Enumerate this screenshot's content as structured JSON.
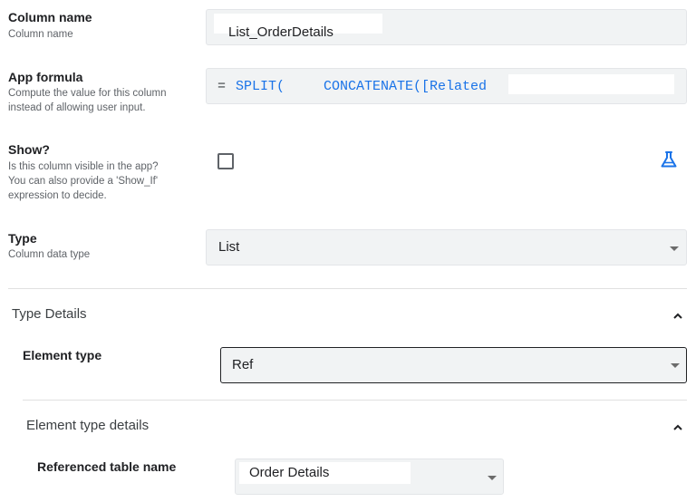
{
  "column_name": {
    "title": "Column name",
    "description": "Column name",
    "value": "List_OrderDetails"
  },
  "app_formula": {
    "title": "App formula",
    "description_line1": "Compute the value for this column",
    "description_line2": "instead of allowing user input.",
    "eq": "=",
    "func1": "SPLIT(",
    "func2": "CONCATENATE([Related"
  },
  "show": {
    "title": "Show?",
    "description_line1": "Is this column visible in the app?",
    "description_line2": "You can also provide a 'Show_If'",
    "description_line3": "expression to decide.",
    "checked": false,
    "icon": "flask-icon"
  },
  "type": {
    "title": "Type",
    "description": "Column data type",
    "selected": "List"
  },
  "type_details": {
    "title": "Type Details",
    "element_type": {
      "label": "Element type",
      "selected": "Ref"
    },
    "element_type_details": {
      "title": "Element type details",
      "referenced_table": {
        "label": "Referenced table name",
        "selected": "Order Details"
      }
    }
  },
  "colors": {
    "accent": "#1a73e8",
    "field_bg": "#f1f3f4"
  }
}
